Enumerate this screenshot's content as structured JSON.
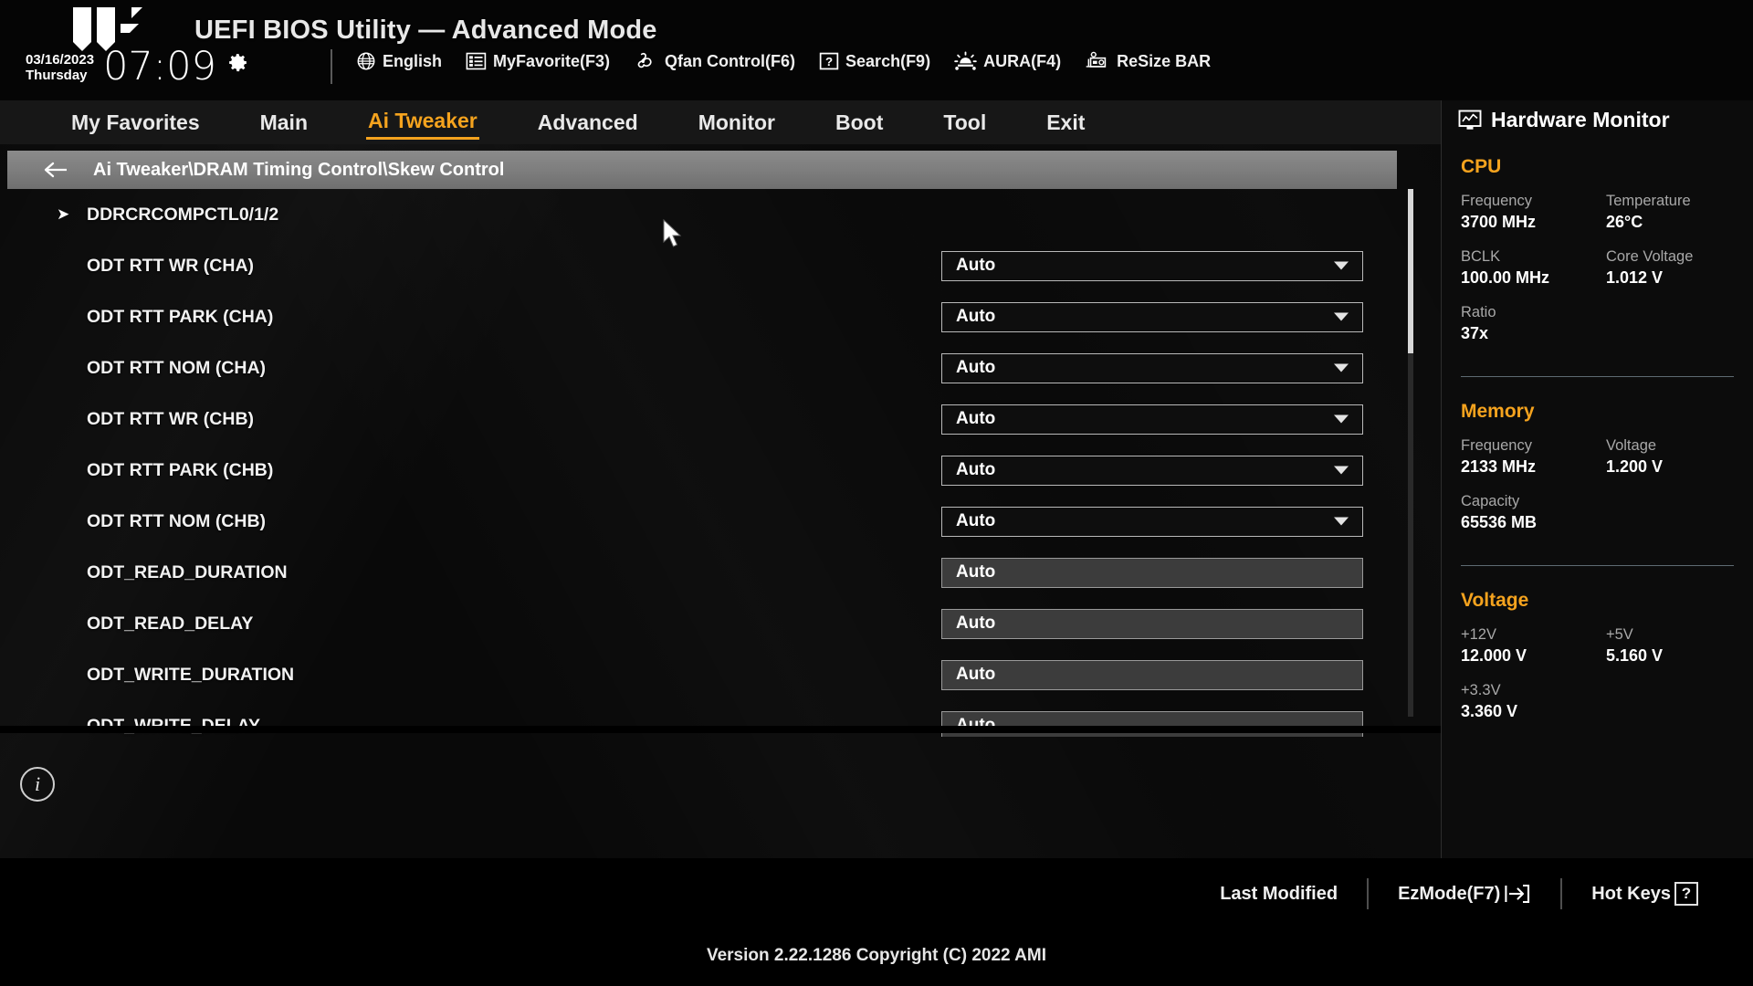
{
  "header": {
    "logo": "tuf-gaming-logo",
    "title": "UEFI BIOS Utility — Advanced Mode",
    "date": "03/16/2023",
    "weekday": "Thursday",
    "clock": "07:09",
    "gear_icon": "gear-icon",
    "tools": [
      {
        "icon": "globe-icon",
        "label": "English"
      },
      {
        "icon": "list-icon",
        "label": "MyFavorite(F3)"
      },
      {
        "icon": "fan-icon",
        "label": "Qfan Control(F6)"
      },
      {
        "icon": "question-icon",
        "label": "Search(F9)"
      },
      {
        "icon": "aura-light-icon",
        "label": "AURA(F4)"
      },
      {
        "icon": "resize-bar-icon",
        "label": "ReSize BAR"
      }
    ]
  },
  "nav": {
    "tabs": [
      {
        "label": "My Favorites",
        "active": false
      },
      {
        "label": "Main",
        "active": false
      },
      {
        "label": "Ai Tweaker",
        "active": true
      },
      {
        "label": "Advanced",
        "active": false
      },
      {
        "label": "Monitor",
        "active": false
      },
      {
        "label": "Boot",
        "active": false
      },
      {
        "label": "Tool",
        "active": false
      },
      {
        "label": "Exit",
        "active": false
      }
    ]
  },
  "breadcrumb": {
    "back_icon": "arrow-left-icon",
    "path": "Ai Tweaker\\DRAM Timing Control\\Skew Control"
  },
  "settings": [
    {
      "label": "DDRCRCOMPCTL0/1/2",
      "type": "submenu",
      "value": "",
      "arrow": "➤"
    },
    {
      "label": "ODT RTT WR (CHA)",
      "type": "dropdown",
      "value": "Auto"
    },
    {
      "label": "ODT RTT PARK (CHA)",
      "type": "dropdown",
      "value": "Auto"
    },
    {
      "label": "ODT RTT NOM (CHA)",
      "type": "dropdown",
      "value": "Auto"
    },
    {
      "label": "ODT RTT WR (CHB)",
      "type": "dropdown",
      "value": "Auto"
    },
    {
      "label": "ODT RTT PARK (CHB)",
      "type": "dropdown",
      "value": "Auto"
    },
    {
      "label": "ODT RTT NOM (CHB)",
      "type": "dropdown",
      "value": "Auto"
    },
    {
      "label": "ODT_READ_DURATION",
      "type": "input",
      "value": "Auto"
    },
    {
      "label": "ODT_READ_DELAY",
      "type": "input",
      "value": "Auto"
    },
    {
      "label": "ODT_WRITE_DURATION",
      "type": "input",
      "value": "Auto"
    },
    {
      "label": "ODT_WRITE_DELAY",
      "type": "input",
      "value": "Auto"
    }
  ],
  "info_icon": "info-icon",
  "hardware_monitor": {
    "icon": "monitor-chart-icon",
    "title": "Hardware Monitor",
    "accent_color": "#f5a31e",
    "sections": [
      {
        "name": "CPU",
        "items": [
          {
            "key": "Frequency",
            "value": "3700 MHz"
          },
          {
            "key": "Temperature",
            "value": "26°C"
          },
          {
            "key": "BCLK",
            "value": "100.00 MHz"
          },
          {
            "key": "Core Voltage",
            "value": "1.012 V"
          },
          {
            "key": "Ratio",
            "value": "37x"
          }
        ]
      },
      {
        "name": "Memory",
        "items": [
          {
            "key": "Frequency",
            "value": "2133 MHz"
          },
          {
            "key": "Voltage",
            "value": "1.200 V"
          },
          {
            "key": "Capacity",
            "value": "65536 MB"
          }
        ]
      },
      {
        "name": "Voltage",
        "items": [
          {
            "key": "+12V",
            "value": "12.000 V"
          },
          {
            "key": "+5V",
            "value": "5.160 V"
          },
          {
            "key": "+3.3V",
            "value": "3.360 V"
          }
        ]
      }
    ]
  },
  "footer": {
    "actions": [
      {
        "label": "Last Modified",
        "icon": ""
      },
      {
        "label": "EzMode(F7)",
        "icon": "exit-arrow-icon"
      },
      {
        "label": "Hot Keys",
        "icon": "question-box-icon"
      }
    ],
    "version": "Version 2.22.1286 Copyright (C) 2022 AMI"
  }
}
